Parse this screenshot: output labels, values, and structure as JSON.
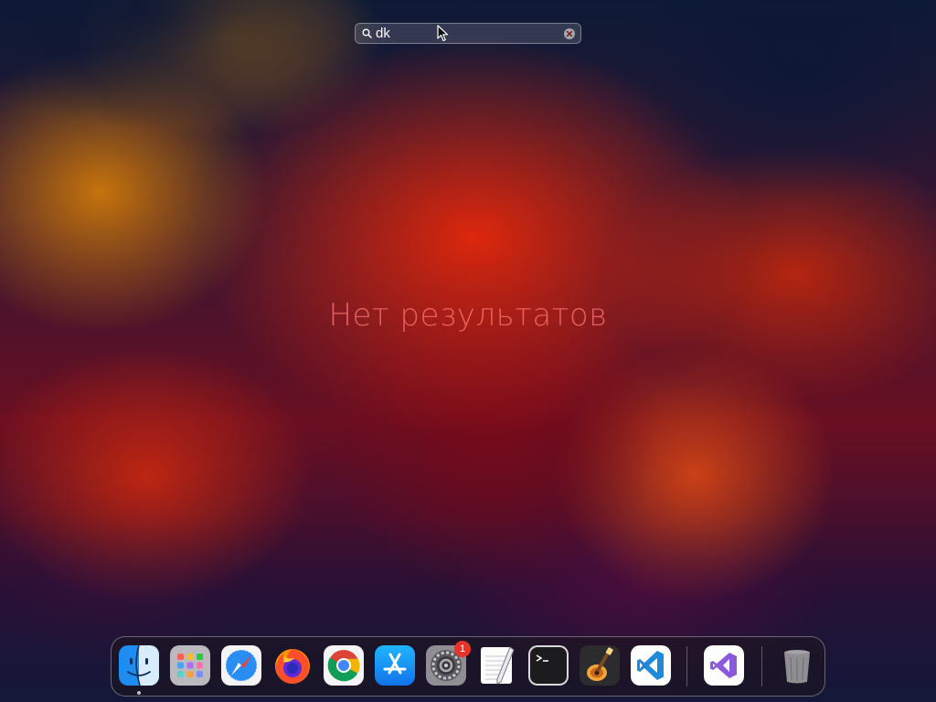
{
  "search": {
    "value": "dk",
    "placeholder": ""
  },
  "main": {
    "no_results_text": "Нет результатов"
  },
  "dock": {
    "items": [
      {
        "app": "Finder",
        "icon": "finder-icon",
        "running": true
      },
      {
        "app": "Launchpad",
        "icon": "launchpad-icon"
      },
      {
        "app": "Safari",
        "icon": "safari-icon"
      },
      {
        "app": "Firefox",
        "icon": "firefox-icon"
      },
      {
        "app": "Google Chrome",
        "icon": "chrome-icon"
      },
      {
        "app": "App Store",
        "icon": "app-store-icon"
      },
      {
        "app": "System Preferences",
        "icon": "system-preferences-icon",
        "badge": "1"
      },
      {
        "app": "TextEdit",
        "icon": "textedit-icon"
      },
      {
        "app": "Terminal",
        "icon": "terminal-icon"
      },
      {
        "app": "GarageBand",
        "icon": "garageband-icon"
      },
      {
        "app": "Visual Studio Code",
        "icon": "vscode-icon"
      },
      {
        "app": "Visual Studio",
        "icon": "visual-studio-icon"
      },
      {
        "app": "Trash",
        "icon": "trash-icon"
      }
    ],
    "system_preferences_badge": "1"
  },
  "colors": {
    "no_results_text": "#ff7878",
    "badge": "#e8322a",
    "search_text": "#ffffff"
  }
}
